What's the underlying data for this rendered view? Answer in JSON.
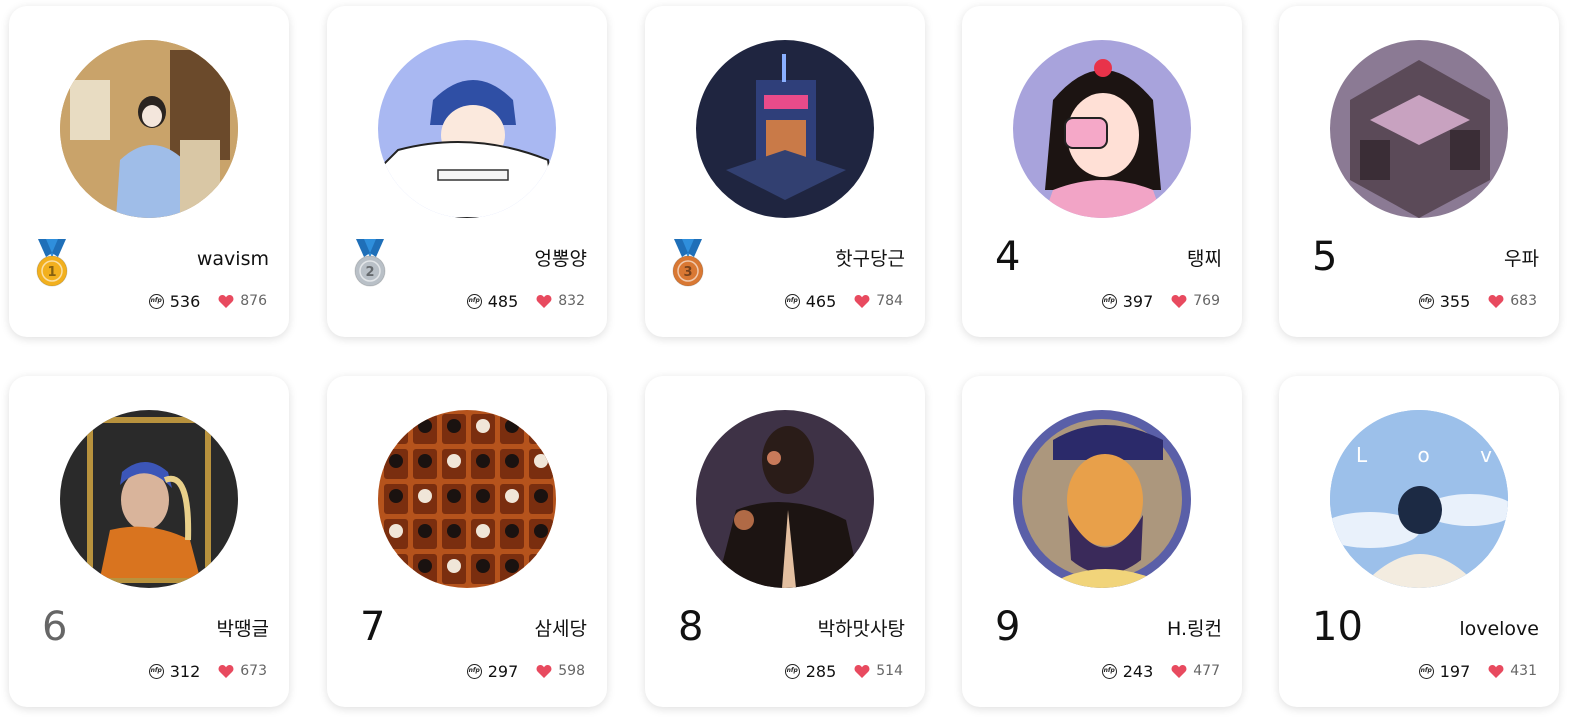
{
  "colors": {
    "heart": "#e84a5f",
    "gold": "#f2b01e",
    "silver": "#b9c0c7",
    "bronze": "#d97833",
    "ribbon": "#2f8fdc"
  },
  "icons": {
    "nfp": "nfp-icon",
    "heart": "heart-icon",
    "medal": "medal-icon"
  },
  "nfp_icon_text": "nfp",
  "ranking": [
    {
      "rank": "1",
      "medal": "gold",
      "medal_digit": "1",
      "name": "wavism",
      "nfp": "536",
      "likes": "876",
      "avatar": "photo-of-woman-waving",
      "bg": "#c9a36a"
    },
    {
      "rank": "2",
      "medal": "silver",
      "medal_digit": "2",
      "name": "엉뽕양",
      "nfp": "485",
      "likes": "832",
      "avatar": "illustration-beanie-girl",
      "bg": "#a9b8f2"
    },
    {
      "rank": "3",
      "medal": "bronze",
      "medal_digit": "3",
      "name": "핫구당근",
      "nfp": "465",
      "likes": "784",
      "avatar": "pixel-art-building",
      "bg": "#1f2540"
    },
    {
      "rank": "4",
      "medal": "",
      "name": "탱찌",
      "nfp": "397",
      "likes": "769",
      "avatar": "illustration-girl-with-phone",
      "bg": "#a8a3dc"
    },
    {
      "rank": "5",
      "medal": "",
      "name": "우파",
      "nfp": "355",
      "likes": "683",
      "avatar": "isometric-room",
      "bg": "#8b7a94"
    },
    {
      "rank": "6",
      "medal": "",
      "name": "박땡글",
      "nfp": "312",
      "likes": "673",
      "avatar": "pearl-earring-parody",
      "bg": "#2a2a2a"
    },
    {
      "rank": "7",
      "medal": "",
      "name": "삼세당",
      "nfp": "297",
      "likes": "598",
      "avatar": "character-grid-poster",
      "bg": "#b5531c"
    },
    {
      "rank": "8",
      "medal": "",
      "name": "박하맛사탕",
      "nfp": "285",
      "likes": "514",
      "avatar": "dark-figure-illustration",
      "bg": "#3e3246"
    },
    {
      "rank": "9",
      "medal": "",
      "name": "H.링컨",
      "nfp": "243",
      "likes": "477",
      "avatar": "lincoln-pop-portrait",
      "bg": "#5a5fa8"
    },
    {
      "rank": "10",
      "medal": "",
      "name": "lovelove",
      "nfp": "197",
      "likes": "431",
      "avatar": "love-sky-illustration",
      "bg": "#8fb6e6"
    }
  ]
}
